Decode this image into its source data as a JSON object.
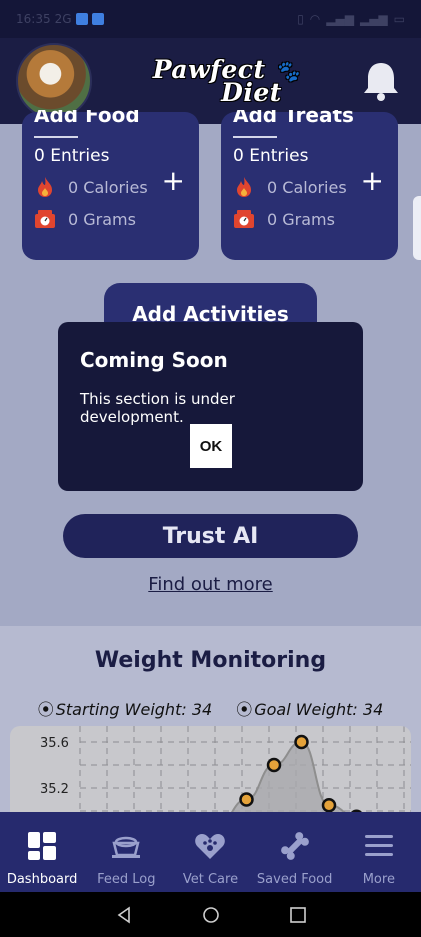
{
  "status_bar": {
    "time": "16:35",
    "network": "2G",
    "notif_icons": [
      "upload-icon",
      "app-icon"
    ],
    "right_icons": [
      "vibrate-icon",
      "wifi-icon",
      "signal-icon",
      "signal-icon",
      "battery-icon"
    ]
  },
  "header": {
    "logo_line1": "Pawfect",
    "logo_line2": "Diet"
  },
  "cards": [
    {
      "title": "Add Food",
      "entries": "0 Entries",
      "calories": "0 Calories",
      "grams": "0 Grams"
    },
    {
      "title": "Add Treats",
      "entries": "0 Entries",
      "calories": "0 Calories",
      "grams": "0 Grams"
    }
  ],
  "add_activities_label": "Add Activities",
  "dialog": {
    "title": "Coming Soon",
    "message": "This section is under development.",
    "ok_label": "OK"
  },
  "trust_ai_label": "Trust AI",
  "find_out_more_label": "Find out more",
  "weight": {
    "title": "Weight Monitoring",
    "starting": "Starting Weight: 34",
    "goal": "Goal Weight: 34"
  },
  "chart_data": {
    "type": "line",
    "y_tick_labels": [
      "35.6",
      "35.2"
    ],
    "values": [
      34.9,
      34.9,
      34.9,
      35.1,
      35.4,
      35.6,
      35.05,
      34.95
    ],
    "ylim": [
      34.9,
      35.7
    ],
    "grid": true,
    "colors": {
      "line": "#8e8e8e",
      "point": "#e4a23a",
      "point_edge": "#111111",
      "fill": "#a9a9ad"
    }
  },
  "bottom_nav": [
    {
      "label": "Dashboard",
      "icon": "dashboard-icon",
      "active": true
    },
    {
      "label": "Feed Log",
      "icon": "bowl-icon",
      "active": false
    },
    {
      "label": "Vet Care",
      "icon": "heart-paw-icon",
      "active": false
    },
    {
      "label": "Saved Food",
      "icon": "bone-icon",
      "active": false
    },
    {
      "label": "More",
      "icon": "menu-icon",
      "active": false
    }
  ]
}
